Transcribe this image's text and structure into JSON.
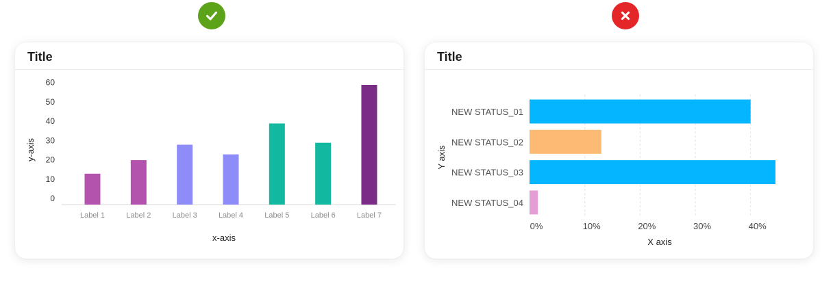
{
  "good_badge": {
    "icon": "checkmark-icon",
    "color": "#5da31a"
  },
  "bad_badge": {
    "icon": "close-icon",
    "color": "#e42628"
  },
  "chart_data": [
    {
      "type": "bar",
      "title": "Title",
      "xlabel": "x-axis",
      "ylabel": "y-axis",
      "categories": [
        "Label 1",
        "Label 2",
        "Label 3",
        "Label 4",
        "Label 5",
        "Label 6",
        "Label 7"
      ],
      "values": [
        16,
        23,
        31,
        26,
        42,
        32,
        62
      ],
      "colors": [
        "#b453ad",
        "#b453ad",
        "#8d8cf8",
        "#8d8cf8",
        "#13b8a0",
        "#13b8a0",
        "#7a2d85"
      ],
      "yticks": [
        0,
        10,
        20,
        30,
        40,
        50,
        60
      ],
      "ylim": [
        0,
        62
      ],
      "grid": false
    },
    {
      "type": "bar",
      "orientation": "horizontal",
      "title": "Title",
      "xlabel": "X axis",
      "ylabel": "Y axis",
      "categories": [
        "NEW STATUS_01",
        "NEW STATUS_02",
        "NEW STATUS_03",
        "NEW STATUS_04"
      ],
      "values": [
        40,
        13,
        44.5,
        1.5
      ],
      "colors": [
        "#04b6ff",
        "#fdba74",
        "#04b6ff",
        "#e59dd7"
      ],
      "xticks": [
        "0%",
        "10%",
        "20%",
        "30%",
        "40%"
      ],
      "xtick_values": [
        0,
        10,
        20,
        30,
        40
      ],
      "xlim": [
        0,
        44.5
      ],
      "grid": "vertical dashed"
    }
  ]
}
